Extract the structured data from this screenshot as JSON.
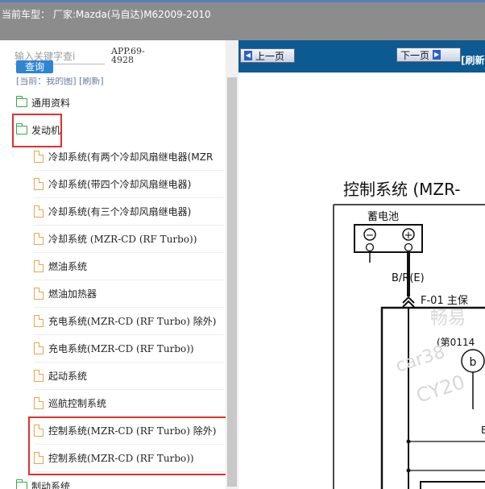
{
  "title_bar": {
    "label": "当前车型：  厂家:Mazda(马自达)M62009-2010"
  },
  "search": {
    "placeholder": "输入关键字查i",
    "button_label": "查询",
    "app_code": "APP.69-\n4928"
  },
  "current_path": "[当前：我的图] [刷新]",
  "tree": {
    "folders": [
      {
        "label": "通用资料"
      },
      {
        "label": "发动机"
      },
      {
        "label": "制动系统"
      }
    ],
    "leaves": [
      {
        "label": "冷却系统(有两个冷却风扇继电器(MZR"
      },
      {
        "label": "冷却系统(带四个冷却风扇继电器)"
      },
      {
        "label": "冷却系统(有三个冷却风扇继电器)"
      },
      {
        "label": "冷却系统 (MZR-CD (RF Turbo))"
      },
      {
        "label": "燃油系统"
      },
      {
        "label": "燃油加热器"
      },
      {
        "label": "充电系统(MZR-CD (RF Turbo)   除外)"
      },
      {
        "label": "充电系统(MZR-CD (RF Turbo))"
      },
      {
        "label": "起动系统"
      },
      {
        "label": "巡航控制系统"
      },
      {
        "label": "控制系统(MZR-CD (RF Turbo)   除外)"
      },
      {
        "label": "控制系统(MZR-CD (RF Turbo))"
      }
    ]
  },
  "viewer": {
    "prev_label": "上一页",
    "next_label": "下一页",
    "refresh_label": "[刷新",
    "diagram": {
      "title": "控制系统 (MZR-",
      "battery_label": "蓄电池",
      "minus_symbol": "−",
      "plus_symbol": "+",
      "wire_label": "B/R(E)",
      "fuse_label": "F-01 主保",
      "ref_label": "(第0114",
      "circle_label": "b",
      "partial_label": "E",
      "watermark_1": "畅易",
      "watermark_2": "car38",
      "watermark_3": "CY20"
    }
  },
  "colors": {
    "title_bg": "#8c8c8c",
    "nav_bg": "#0b5a92",
    "highlight": "#e03030",
    "folder": "#3aa84a",
    "doc": "#e8a54b",
    "query_btn": "#2e86d1"
  }
}
